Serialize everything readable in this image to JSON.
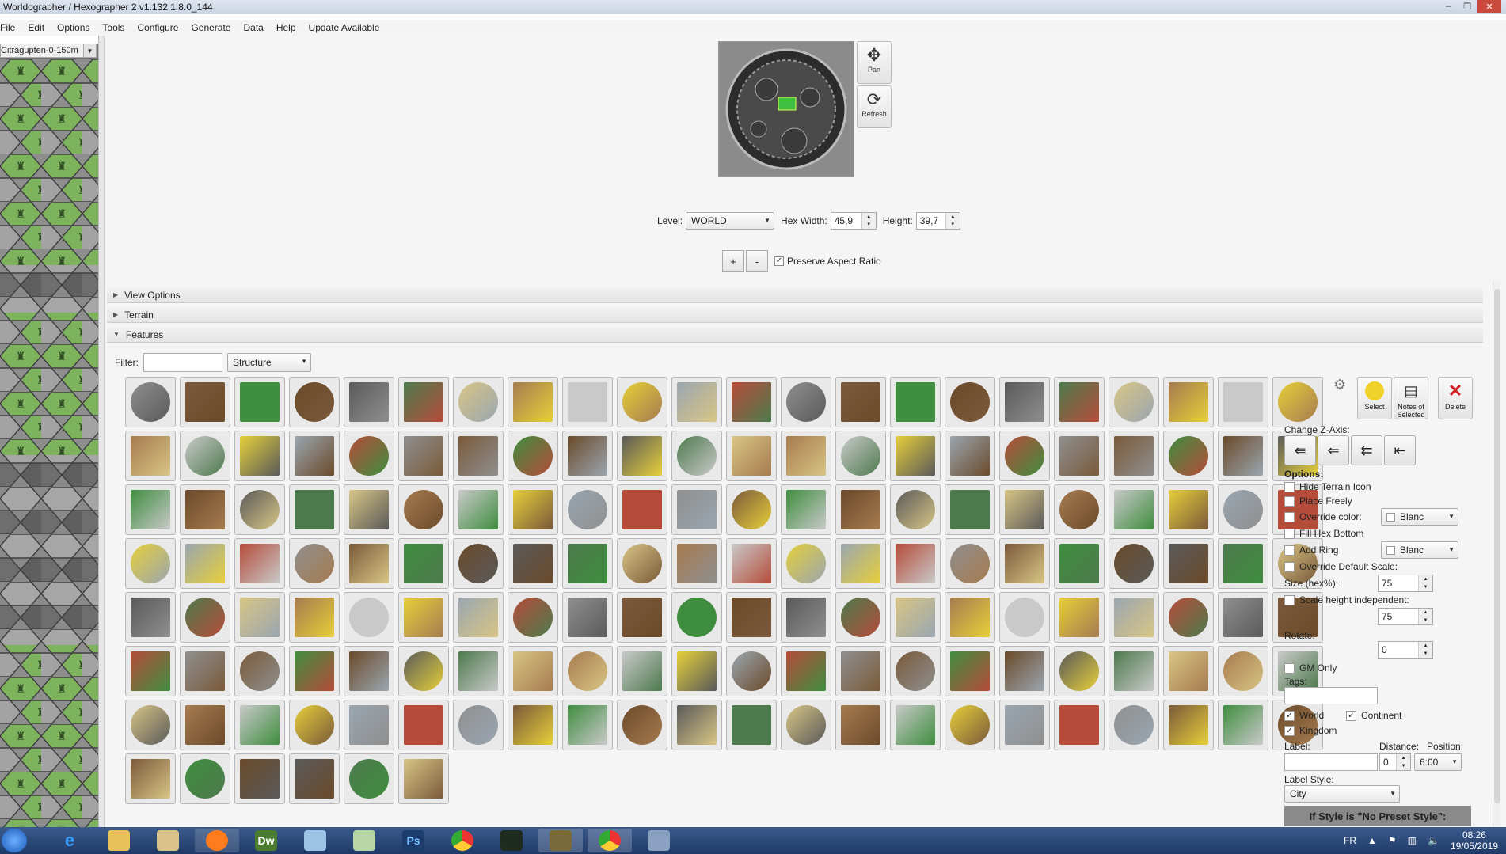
{
  "window": {
    "title": "Worldographer / Hexographer 2 v1.132 1.8.0_144",
    "controls": [
      "–",
      "❐",
      "✕"
    ]
  },
  "menu": [
    "File",
    "Edit",
    "Options",
    "Tools",
    "Configure",
    "Generate",
    "Data",
    "Help",
    "Update Available"
  ],
  "map_selector": "Citragupten-0-150m",
  "tools": {
    "pan": "Pan",
    "refresh": "Refresh"
  },
  "level": {
    "label": "Level:",
    "value": "WORLD"
  },
  "hex_width": {
    "label": "Hex Width:",
    "value": "45,9"
  },
  "height": {
    "label": "Height:",
    "value": "39,7"
  },
  "zoom": {
    "plus": "+",
    "minus": "-",
    "preserve": "Preserve Aspect Ratio",
    "preserve_checked": true
  },
  "sections": {
    "view_options": "View Options",
    "terrain": "Terrain",
    "features": "Features"
  },
  "filter": {
    "label": "Filter:",
    "value": "",
    "category": "Structure"
  },
  "tile_rows": [
    22,
    22,
    22,
    22,
    22,
    22,
    22,
    6
  ],
  "panel": {
    "select": "Select",
    "notes": "Notes of Selected",
    "delete": "Delete",
    "change_z": "Change Z-Axis:",
    "options_title": "Options:",
    "hide_terrain": "Hide Terrain Icon",
    "place_freely": "Place Freely",
    "override_color": "Override color:",
    "override_color_value": "Blanc",
    "fill_hex_bottom": "Fill Hex Bottom",
    "add_ring": "Add Ring",
    "add_ring_value": "Blanc",
    "override_scale": "Override Default Scale:",
    "size_label": "Size (hex%):",
    "size_value": "75",
    "scale_height": "Scale height independent:",
    "scale_height_value": "75",
    "rotate_label": "Rotate:",
    "rotate_value": "0",
    "gm_only": "GM Only",
    "tags_label": "Tags:",
    "world": "World",
    "continent": "Continent",
    "kingdom": "Kingdom",
    "label_label": "Label:",
    "distance_label": "Distance:",
    "position_label": "Position:",
    "distance_value": "0",
    "position_value": "6:00",
    "label_style_label": "Label Style:",
    "label_style_value": "City",
    "hint": "If Style is \"No Preset Style\":"
  },
  "taskbar": {
    "lang": "FR",
    "time": "08:26",
    "date": "19/05/2019",
    "dw": "Dw",
    "ps": "Ps"
  },
  "colors": {
    "accent": "#3b5a8c",
    "hex_green": "#7aab5b",
    "hex_gray": "#9a9a9a"
  }
}
